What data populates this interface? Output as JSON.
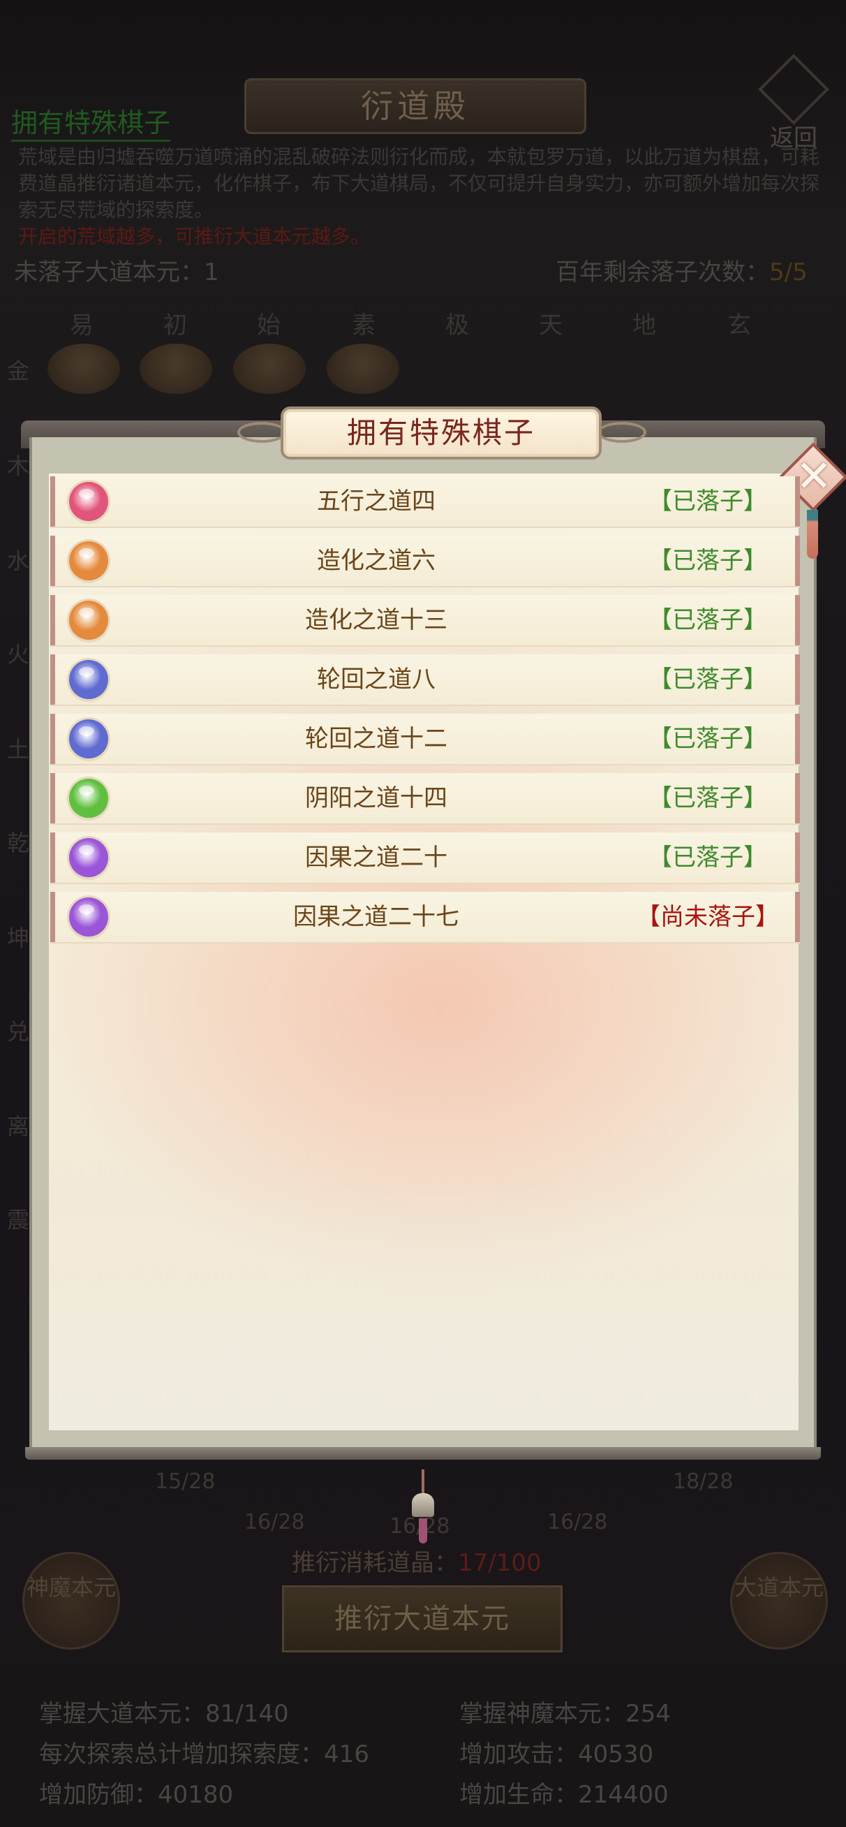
{
  "background": {
    "screen_title": "衍道殿",
    "return_label": "返回",
    "section_title": "拥有特殊棋子",
    "description": "荒域是由归墟吞噬万道喷涌的混乱破碎法则衍化而成，本就包罗万道，以此万道为棋盘，可耗费道晶推衍诸道本元，化作棋子，布下大道棋局，不仅可提升自身实力，亦可额外增加每次探索无尽荒域的探索度。",
    "description_red": "开启的荒域越多，可推衍大道本元越多。",
    "unplaced_label": "未落子大道本元：1",
    "remaining_label": "百年剩余落子次数：",
    "remaining_value": "5/5",
    "columns": [
      "易",
      "初",
      "始",
      "素",
      "极",
      "天",
      "地",
      "玄"
    ],
    "rows": [
      "金",
      "木",
      "水",
      "火",
      "土",
      "乾",
      "坤",
      "兑",
      "离",
      "震"
    ],
    "fractions": [
      "15/28",
      "16/28",
      "16/28",
      "16/28",
      "18/28"
    ],
    "cost_label": "推衍消耗道晶：",
    "cost_value": "17/100",
    "main_button": "推衍大道本元",
    "left_round_button": "神魔本元",
    "right_round_button": "大道本元",
    "stats": [
      "掌握大道本元：81/140",
      "掌握神魔本元：254",
      "每次探索总计增加探索度：416",
      "增加攻击：40530",
      "增加防御：40180",
      "增加生命：214400"
    ]
  },
  "modal": {
    "title": "拥有特殊棋子",
    "close_icon": "close-icon",
    "items": [
      {
        "name": "五行之道四",
        "status": "【已落子】",
        "status_color": "#3f8a2c",
        "orb_color": "#e2557a",
        "orb_icon": "chess-piece-icon"
      },
      {
        "name": "造化之道六",
        "status": "【已落子】",
        "status_color": "#3f8a2c",
        "orb_color": "#e58a3c",
        "orb_icon": "chess-piece-icon"
      },
      {
        "name": "造化之道十三",
        "status": "【已落子】",
        "status_color": "#3f8a2c",
        "orb_color": "#e58a3c",
        "orb_icon": "chess-piece-icon"
      },
      {
        "name": "轮回之道八",
        "status": "【已落子】",
        "status_color": "#3f8a2c",
        "orb_color": "#5f6bd1",
        "orb_icon": "chess-piece-icon"
      },
      {
        "name": "轮回之道十二",
        "status": "【已落子】",
        "status_color": "#3f8a2c",
        "orb_color": "#5f6bd1",
        "orb_icon": "chess-piece-icon"
      },
      {
        "name": "阴阳之道十四",
        "status": "【已落子】",
        "status_color": "#3f8a2c",
        "orb_color": "#5fbf3e",
        "orb_icon": "chess-piece-icon"
      },
      {
        "name": "因果之道二十",
        "status": "【已落子】",
        "status_color": "#3f8a2c",
        "orb_color": "#9a55d8",
        "orb_icon": "chess-piece-icon"
      },
      {
        "name": "因果之道二十七",
        "status": "【尚未落子】",
        "status_color": "#a8150f",
        "orb_color": "#9a55d8",
        "orb_icon": "chess-piece-icon"
      }
    ]
  }
}
